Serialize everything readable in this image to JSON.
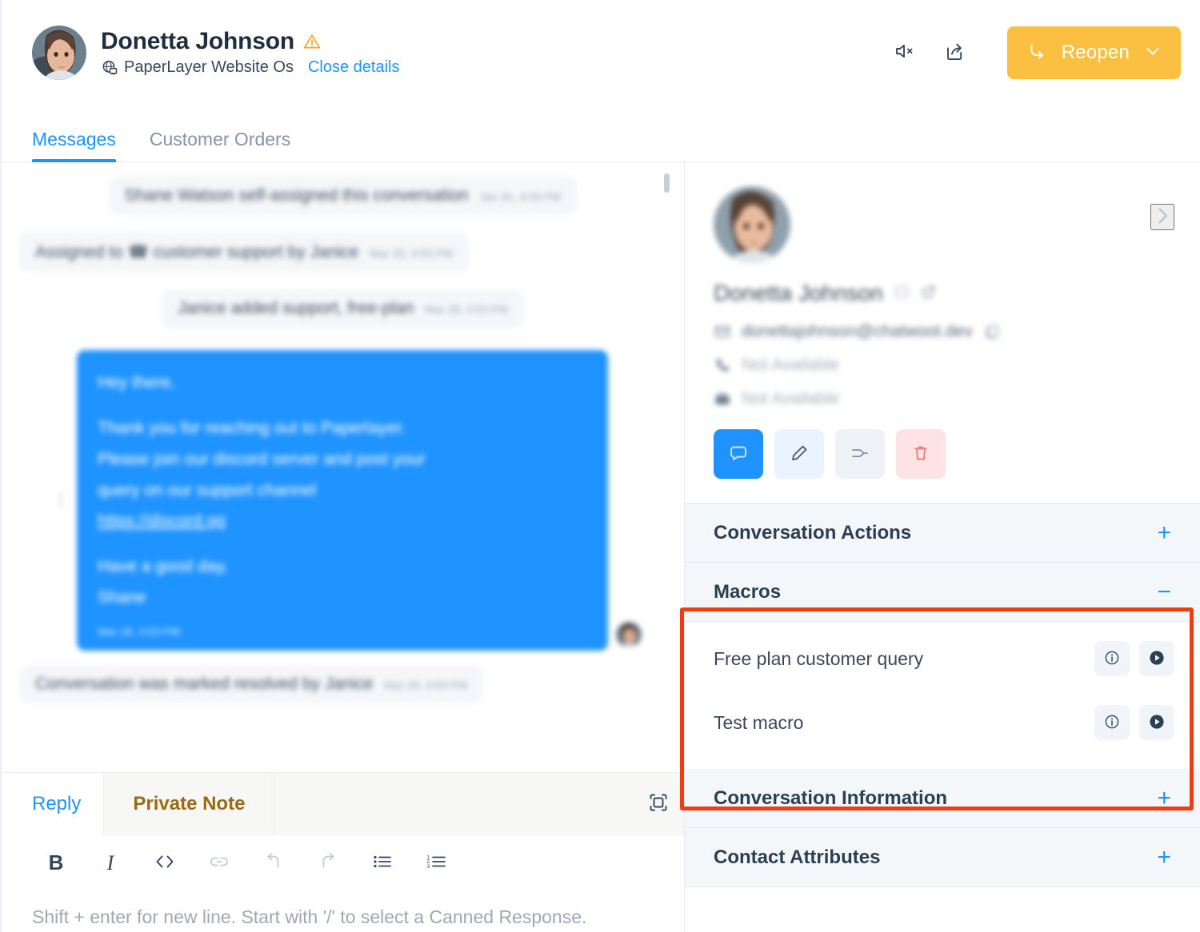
{
  "header": {
    "contact_name": "Donetta Johnson",
    "warning_icon": "warning-triangle-icon",
    "inbox_icon": "globe-desktop-icon",
    "inbox_name": "PaperLayer Website Os",
    "close_details_label": "Close details",
    "mute_icon": "speaker-mute-icon",
    "share_icon": "share-external-icon",
    "reopen_icon": "reopen-arrow-icon",
    "reopen_label": "Reopen",
    "reopen_chevron_icon": "chevron-down-icon",
    "reopen_color": "#FBC042"
  },
  "tabs": [
    {
      "label": "Messages",
      "active": true
    },
    {
      "label": "Customer Orders",
      "active": false
    }
  ],
  "conversation": {
    "system_messages": [
      {
        "text": "Shane Watson self-assigned this conversation",
        "time": "Jan 31, 4:55 PM",
        "align": "center"
      },
      {
        "text": "Assigned to ☎ customer support by Janice",
        "time": "Mar 28, 3:53 PM",
        "align": "left"
      },
      {
        "text": "Janice added support, free-plan",
        "time": "Mar 28, 3:53 PM",
        "align": "center"
      }
    ],
    "outgoing_message": {
      "greeting": "Hey there,",
      "body_line_1": "Thank you for reaching out to Paperlayer.",
      "body_line_2": "Please join our discord server and post your",
      "body_line_3": "query on our support channel",
      "link_text": "https://discord.gg",
      "sign_off": "Have a good day,",
      "sender": "Shane",
      "time": "Mar 28, 3:53 PM"
    },
    "resolved_message": {
      "text": "Conversation was marked resolved by Janice",
      "time": "Mar 28, 3:53 PM"
    }
  },
  "reply_editor": {
    "tabs": [
      {
        "label": "Reply",
        "active": true
      },
      {
        "label": "Private Note",
        "active": false
      }
    ],
    "expand_icon": "expand-fullscreen-icon",
    "format_buttons": [
      {
        "name": "bold-button",
        "glyph": "B",
        "disabled": false
      },
      {
        "name": "italic-button",
        "glyph": "I",
        "disabled": false
      },
      {
        "name": "code-button",
        "glyph": "code-icon",
        "disabled": false
      },
      {
        "name": "link-button",
        "glyph": "link-icon",
        "disabled": true
      },
      {
        "name": "undo-button",
        "glyph": "undo-icon",
        "disabled": true
      },
      {
        "name": "redo-button",
        "glyph": "redo-icon",
        "disabled": true
      },
      {
        "name": "bullet-list-button",
        "glyph": "bullet-list-icon",
        "disabled": false
      },
      {
        "name": "ordered-list-button",
        "glyph": "ordered-list-icon",
        "disabled": false
      }
    ],
    "placeholder": "Shift + enter for new line. Start with '/' to select a Canned Response."
  },
  "sidebar": {
    "contact": {
      "name": "Donetta Johnson",
      "status_icon": "availability-circle-icon",
      "external_link_icon": "external-link-icon",
      "expand_chevron_icon": "chevron-right-icon",
      "email_icon": "email-icon",
      "email": "donettajohnson@chatwoot.dev",
      "copy_icon": "copy-icon",
      "phone_icon": "phone-icon",
      "phone": "Not Available",
      "company_icon": "briefcase-icon",
      "company": "Not Available",
      "actions": [
        {
          "name": "new-conversation-button",
          "icon": "chat-bubble-icon",
          "style": "primary"
        },
        {
          "name": "edit-contact-button",
          "icon": "pencil-icon",
          "style": "light"
        },
        {
          "name": "merge-contact-button",
          "icon": "merge-icon",
          "style": "grey"
        },
        {
          "name": "delete-contact-button",
          "icon": "trash-icon",
          "style": "red"
        }
      ]
    },
    "sections": [
      {
        "title": "Conversation Actions",
        "toggle": "+",
        "expanded": false
      },
      {
        "title": "Macros",
        "toggle": "−",
        "expanded": true
      },
      {
        "title": "Conversation Information",
        "toggle": "+",
        "expanded": false
      },
      {
        "title": "Contact Attributes",
        "toggle": "+",
        "expanded": false
      }
    ],
    "macros": [
      {
        "name": "Free plan customer query",
        "info_icon": "info-circle-icon",
        "run_icon": "play-circle-icon"
      },
      {
        "name": "Test macro",
        "info_icon": "info-circle-icon",
        "run_icon": "play-circle-icon"
      }
    ],
    "highlight_color": "#f03c11"
  }
}
